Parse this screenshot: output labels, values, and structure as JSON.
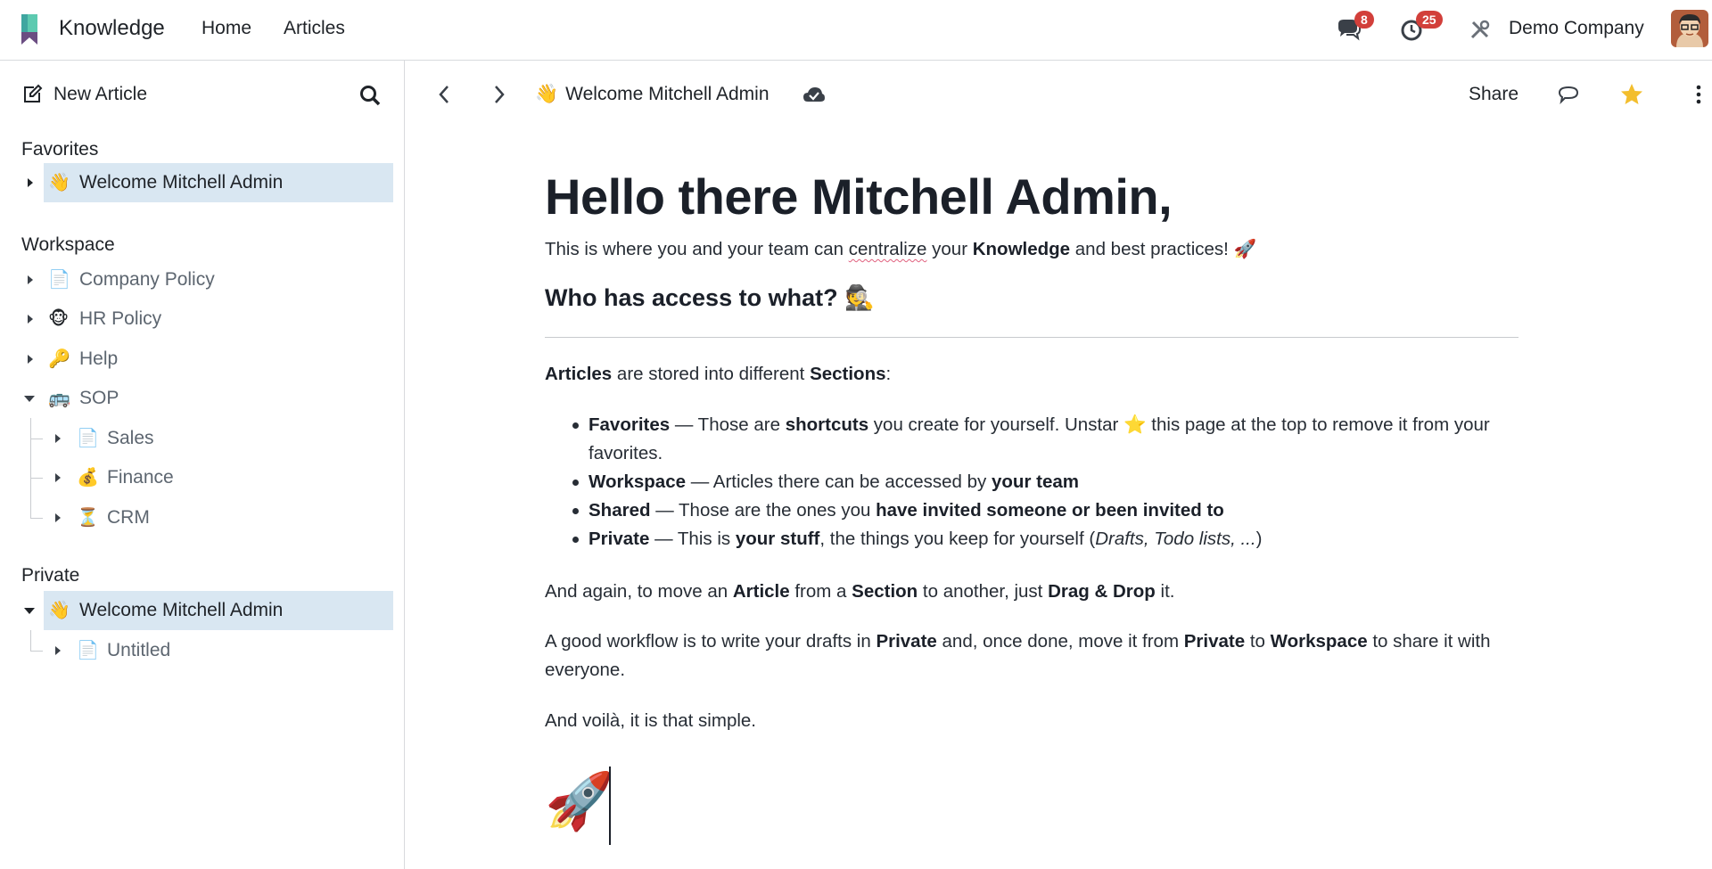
{
  "navbar": {
    "app_name": "Knowledge",
    "menu": [
      "Home",
      "Articles"
    ],
    "messages_badge": "8",
    "activities_badge": "25",
    "company": "Demo Company",
    "icons": [
      "messages-icon",
      "activities-icon",
      "settings-tools-icon"
    ]
  },
  "sidebar": {
    "new_article": "New Article",
    "favorites_title": "Favorites",
    "favorites": [
      {
        "emoji": "👋",
        "label": "Welcome Mitchell Admin"
      }
    ],
    "workspace_title": "Workspace",
    "workspace": [
      {
        "emoji": "📄",
        "label": "Company Policy"
      },
      {
        "emoji": "🐵",
        "label": "HR Policy"
      },
      {
        "emoji": "🔑",
        "label": "Help"
      },
      {
        "emoji": "🚌",
        "label": "SOP"
      },
      {
        "emoji": "📄",
        "label": "Sales"
      },
      {
        "emoji": "💰",
        "label": "Finance"
      },
      {
        "emoji": "⏳",
        "label": "CRM"
      }
    ],
    "private_title": "Private",
    "private": [
      {
        "emoji": "👋",
        "label": "Welcome Mitchell Admin"
      },
      {
        "emoji": "📄",
        "label": "Untitled"
      }
    ]
  },
  "header": {
    "breadcrumb_emoji": "👋",
    "breadcrumb_title": "Welcome Mitchell Admin",
    "share_label": "Share"
  },
  "article": {
    "title": "Hello there Mitchell Admin,",
    "intro_1": "This is where you and your team can ",
    "intro_2": "centralize",
    "intro_3": " your ",
    "intro_4": "Knowledge",
    "intro_5": " and best practices! 🚀",
    "h2": "Who has access to what? 🕵️",
    "articles_1": "Articles",
    "articles_2": " are stored into different ",
    "articles_3": "Sections",
    "articles_4": ":",
    "li1_a": "Favorites",
    "li1_b": " — Those are ",
    "li1_c": "shortcuts",
    "li1_d": " you create for yourself. Unstar ⭐ this page at the top to remove it from your favorites.",
    "li2_a": "Workspace",
    "li2_b": " — Articles there can be accessed by ",
    "li2_c": "your team",
    "li3_a": "Shared",
    "li3_b": " — Those are the ones you ",
    "li3_c": "have invited someone or been invited to",
    "li4_a": "Private",
    "li4_b": " — This is ",
    "li4_c": "your stuff",
    "li4_d": ", the things you keep for yourself (",
    "li4_e": "Drafts, Todo lists, ...",
    "li4_f": ")",
    "again_1": "And again, to move an ",
    "again_2": "Article",
    "again_3": " from a ",
    "again_4": "Section",
    "again_5": " to another, just ",
    "again_6": "Drag & Drop",
    "again_7": " it.",
    "wf_1": "A good workflow is to write your drafts in ",
    "wf_2": "Private",
    "wf_3": " and, once done, move it from ",
    "wf_4": "Private",
    "wf_5": " to ",
    "wf_6": "Workspace",
    "wf_7": " to share it with everyone.",
    "voila": "And voilà, it is that simple.",
    "rocket": "🚀"
  }
}
